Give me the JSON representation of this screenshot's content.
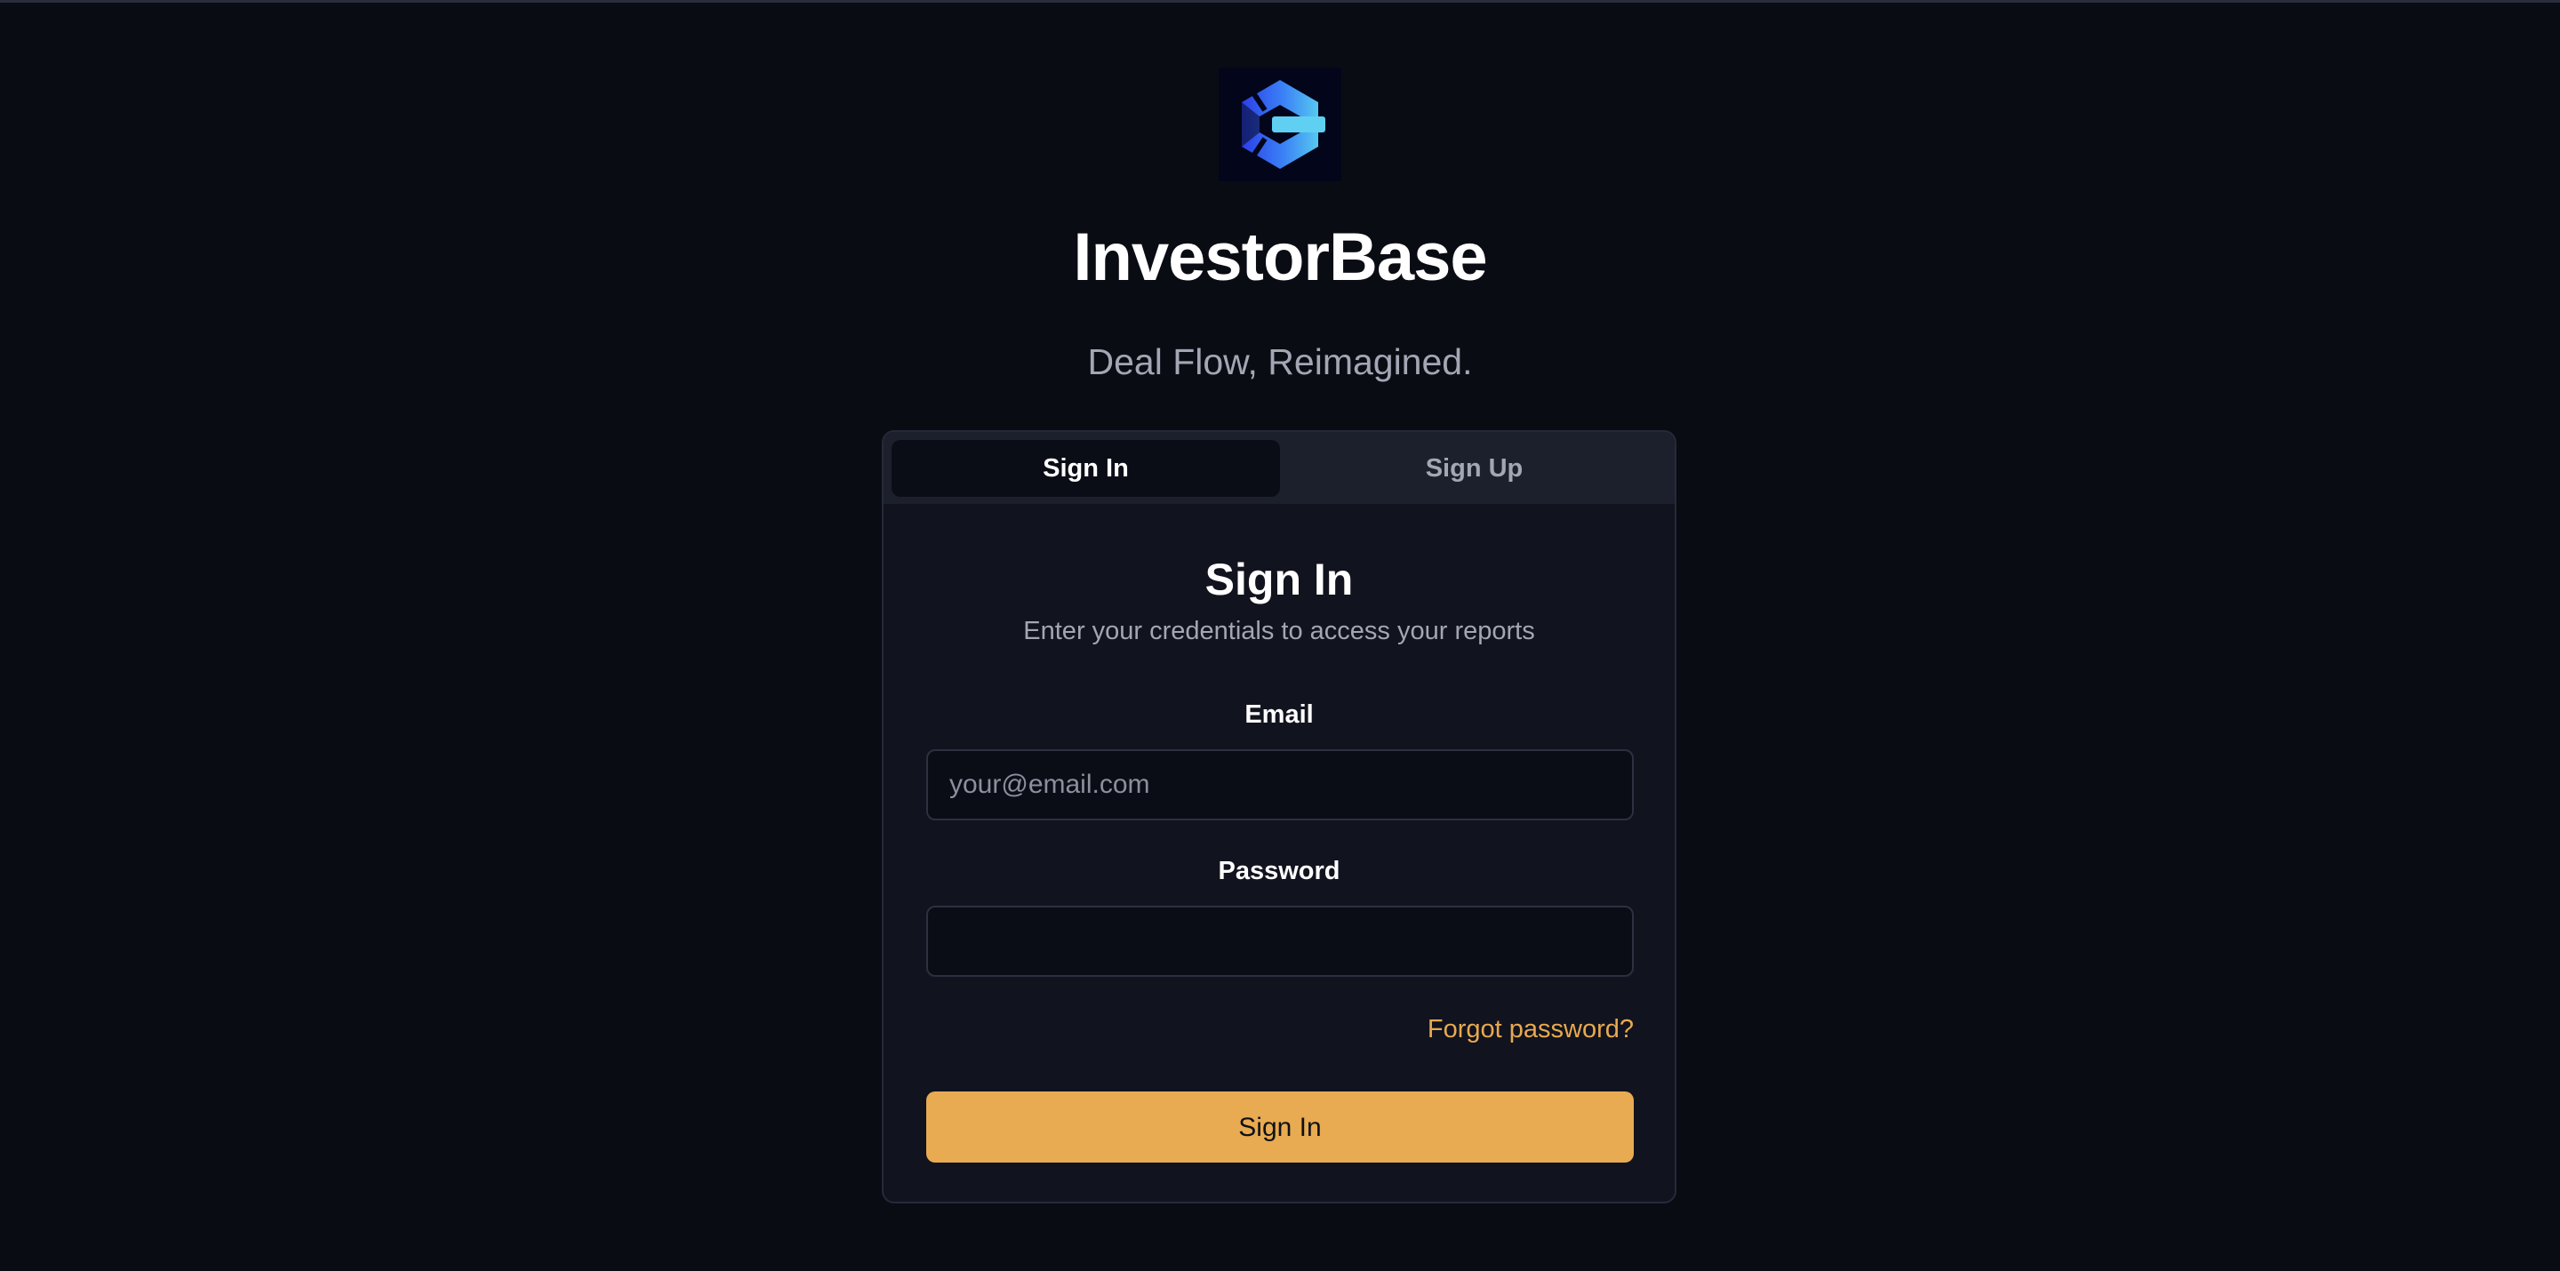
{
  "brand": {
    "name": "InvestorBase",
    "tagline": "Deal Flow, Reimagined.",
    "logo_icon": "hexagon-logo-icon",
    "logo_colors": [
      "#2b3fe8",
      "#3b82f6",
      "#56c8f0"
    ]
  },
  "auth": {
    "tabs": [
      {
        "label": "Sign In",
        "active": true
      },
      {
        "label": "Sign Up",
        "active": false
      }
    ],
    "form": {
      "title": "Sign In",
      "subtitle": "Enter your credentials to access your reports",
      "email_label": "Email",
      "email_placeholder": "your@email.com",
      "email_value": "",
      "password_label": "Password",
      "password_value": "",
      "forgot_label": "Forgot password?",
      "submit_label": "Sign In"
    }
  },
  "colors": {
    "background": "#0a0c14",
    "card": "#11131f",
    "accent": "#e8ab52",
    "link": "#e8a94f",
    "muted_text": "#a3a6b3"
  }
}
